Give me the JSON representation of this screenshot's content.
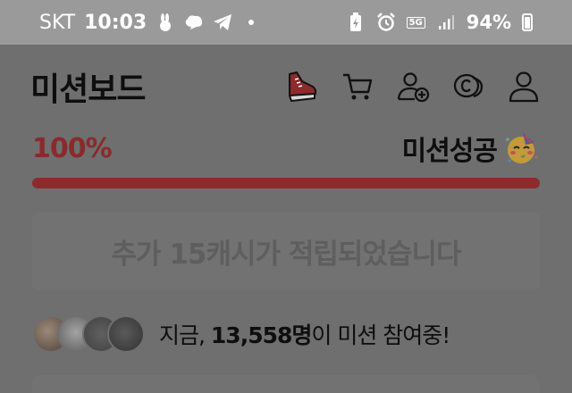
{
  "status_bar": {
    "carrier": "SKT",
    "time": "10:03",
    "network": "5G",
    "battery": "94%",
    "left_icons": [
      "rabbit-icon",
      "cloud-message-icon",
      "telegram-icon"
    ],
    "right_icons": [
      "battery-saver-icon",
      "alarm-icon",
      "signal-icon"
    ]
  },
  "header": {
    "title": "미션보드",
    "icons": [
      "sneaker-icon",
      "cart-icon",
      "add-user-icon",
      "coin-icon",
      "profile-icon"
    ]
  },
  "progress": {
    "percent_label": "100%",
    "value": 1.0,
    "status_label": "미션성공",
    "emoji": "party-face-emoji",
    "color": "#8c2a2c"
  },
  "reward": {
    "message": "추가 15캐시가 적립되었습니다"
  },
  "participants": {
    "prefix": "지금, ",
    "count": "13,558명",
    "suffix": "이 미션 참여중!",
    "avatar_count": 4
  }
}
